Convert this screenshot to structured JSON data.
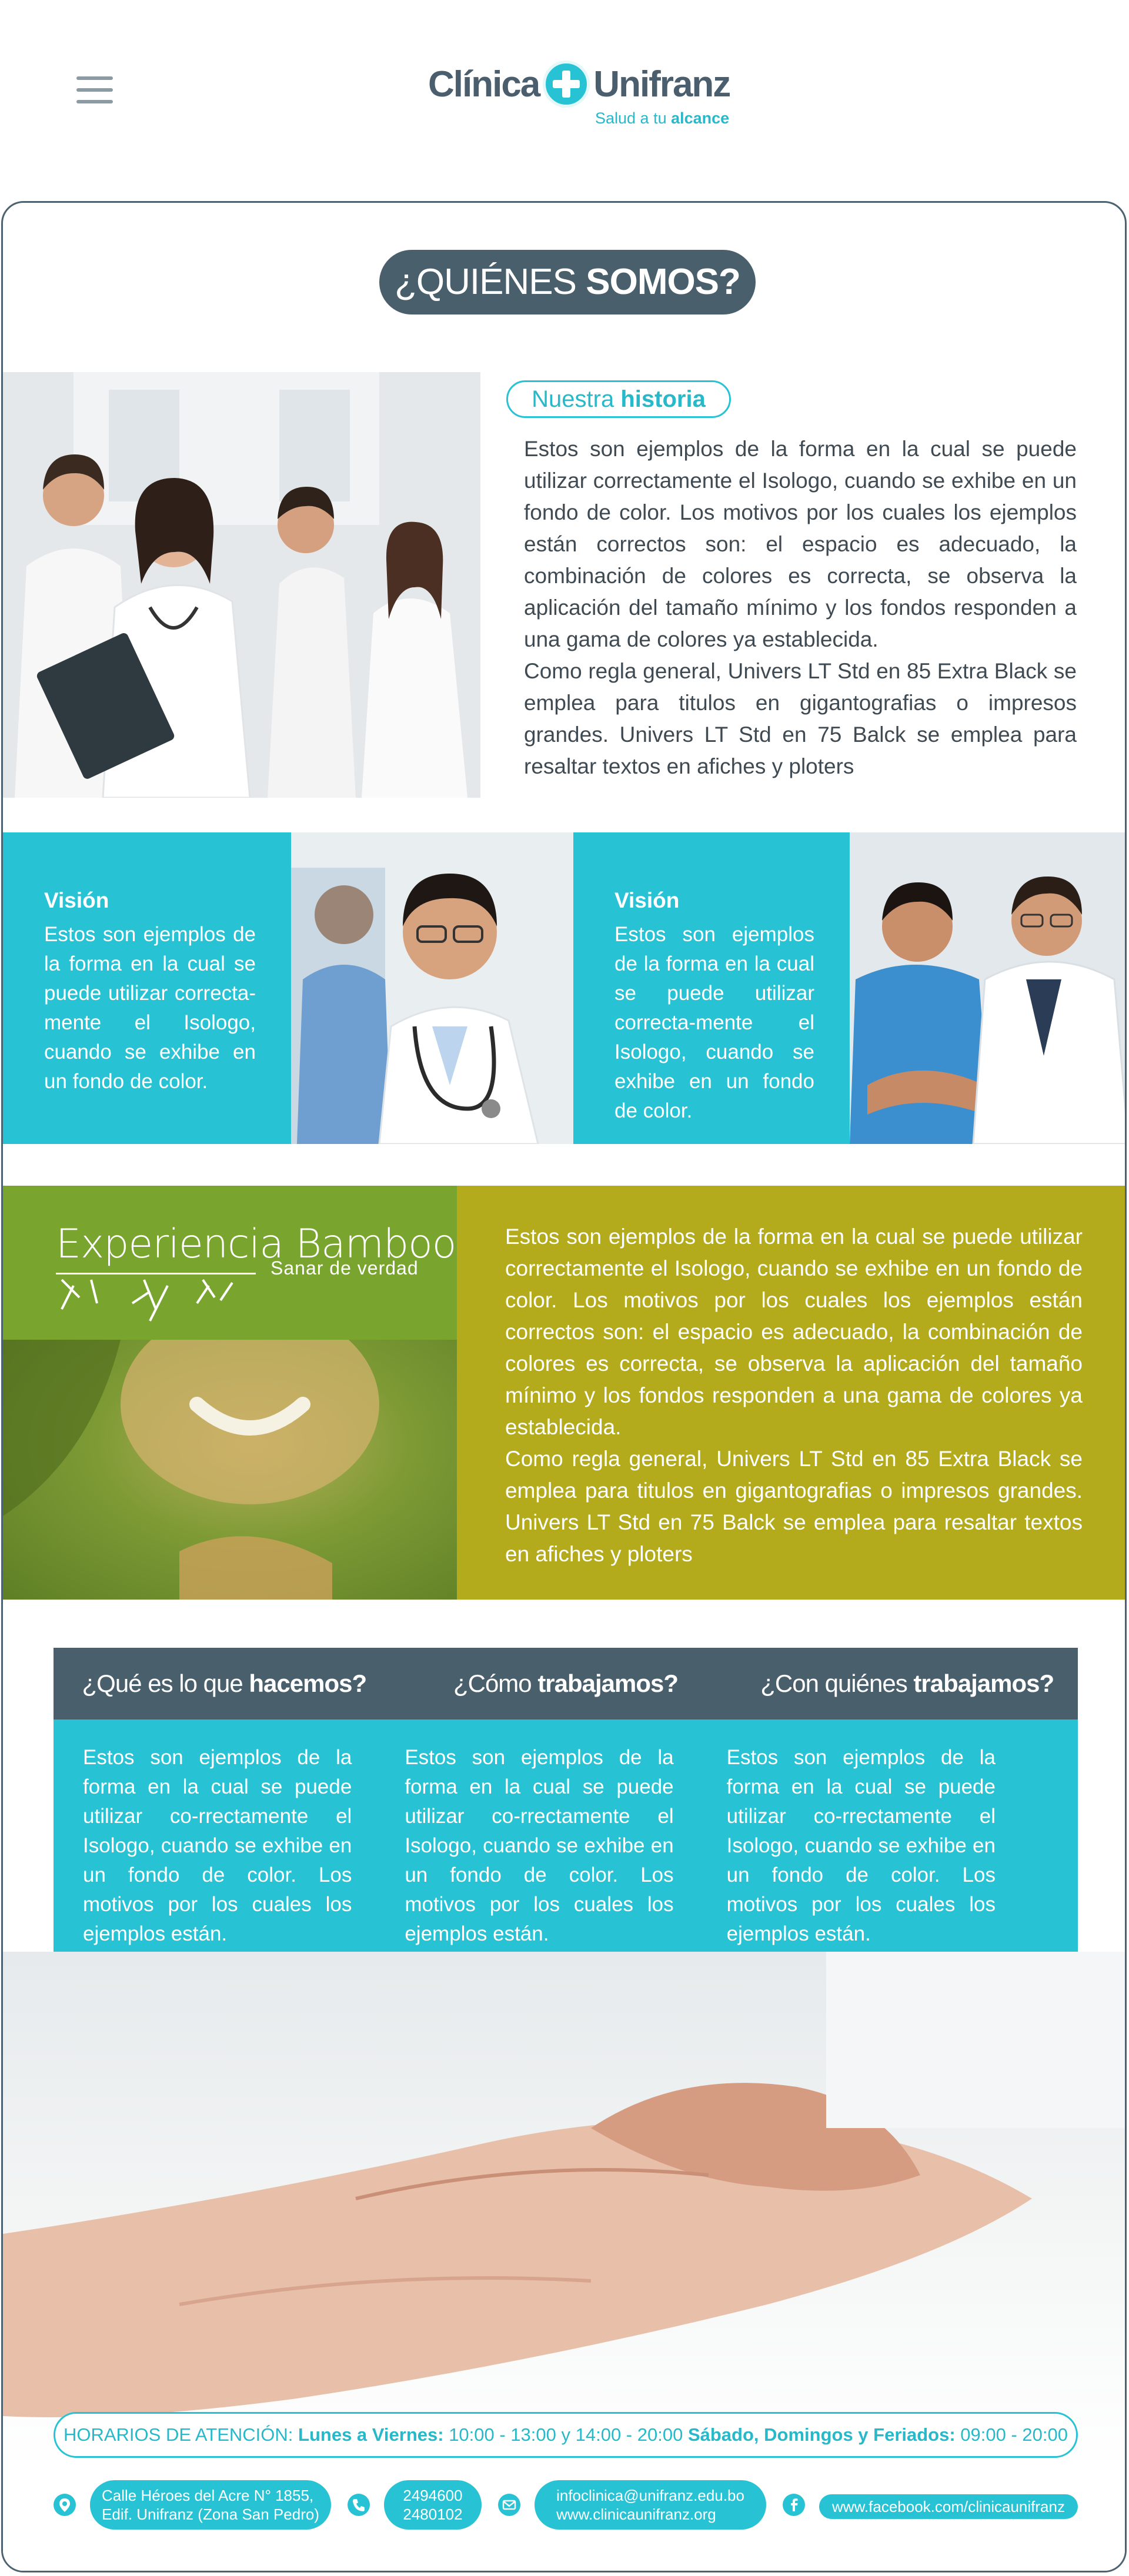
{
  "header": {
    "logo_left": "Clínica",
    "logo_right": "Unifranz",
    "tagline_prefix": "Salud a tu ",
    "tagline_bold": "alcance"
  },
  "about": {
    "title_light": "¿QUIÉNES ",
    "title_bold": "SOMOS?",
    "history_light": "Nuestra ",
    "history_bold": "historia",
    "history_p1": "Estos son ejemplos de la forma en la cual se puede utilizar correctamente el Isologo, cuando se exhibe en un fondo de color. Los motivos por los cuales los ejemplos están correctos son: el espacio es adecuado, la combinación de colores es correcta, se observa la aplicación del tamaño mínimo y los fondos responden a una gama de colores ya establecida.",
    "history_p2": "Como regla general, Univers LT Std en 85 Extra Black se emplea para titulos en gigantografias o impresos grandes. Univers LT Std en 75 Balck se emplea para resaltar textos en afiches y ploters"
  },
  "vision": [
    {
      "title": "Visión",
      "text": "Estos son ejemplos de la forma en la cual se puede utilizar correcta-mente el Isologo, cuando se exhibe en un fondo de color."
    },
    {
      "title": "Visión",
      "text": "Estos son ejemplos de la forma en la cual se puede utilizar correcta-mente el Isologo, cuando se exhibe en un fondo de color."
    }
  ],
  "bamboo": {
    "title": "Experiencia Bamboo",
    "subtitle": "Sanar de verdad",
    "p1": "Estos son ejemplos de la forma en la cual se puede utilizar correctamente el Isologo, cuando se exhibe en un fondo de color. Los motivos por los cuales los ejemplos están correctos son: el espacio es adecuado, la combinación de colores es correcta, se observa la aplicación del tamaño mínimo y los fondos responden a una gama de colores ya establecida.",
    "p2": "Como regla general, Univers LT Std en 85 Extra Black se emplea para titulos en gigantografias o impresos grandes. Univers LT Std en 75 Balck se emplea para resaltar textos en afiches y ploters"
  },
  "services": [
    {
      "light": "¿Qué es lo que ",
      "bold": "hacemos?",
      "text": "Estos son ejemplos de la forma en la cual se puede utilizar co-rrectamente el Isologo, cuando se exhibe en un fondo de color. Los motivos por los cuales los ejemplos están."
    },
    {
      "light": "¿Cómo ",
      "bold": "trabajamos?",
      "text": "Estos son ejemplos de la forma en la cual se puede utilizar co-rrectamente el Isologo, cuando se exhibe en un fondo de color. Los motivos por los cuales los ejemplos están."
    },
    {
      "light": "¿Con quiénes ",
      "bold": "trabajamos?",
      "text": "Estos son ejemplos de la forma en la cual se puede utilizar co-rrectamente el Isologo, cuando se exhibe en un fondo de color. Los motivos por los cuales los ejemplos están."
    }
  ],
  "hours": {
    "label": "HORARIOS DE ATENCIÓN: ",
    "weekday_label": "Lunes a Viernes: ",
    "weekday_time": "10:00 - 13:00 y 14:00 - 20:00  ",
    "weekend_label": "Sábado, Domingos y Feriados: ",
    "weekend_time": "09:00 - 20:00"
  },
  "contact": {
    "address_line1": "Calle Héroes del Acre N° 1855,",
    "address_line2": "Edif. Unifranz (Zona San Pedro)",
    "phone1": "2494600",
    "phone2": "2480102",
    "email": "infoclinica@unifranz.edu.bo",
    "web": "www.clinicaunifranz.org",
    "facebook": "www.facebook.com/clinicaunifranz",
    "icons": [
      "location-icon",
      "phone-icon",
      "mail-icon",
      "facebook-icon"
    ]
  },
  "colors": {
    "turquoise": "#27c3d4",
    "slate": "#4a5f6c",
    "olive": "#b3aa1c",
    "green": "#79a52e"
  }
}
